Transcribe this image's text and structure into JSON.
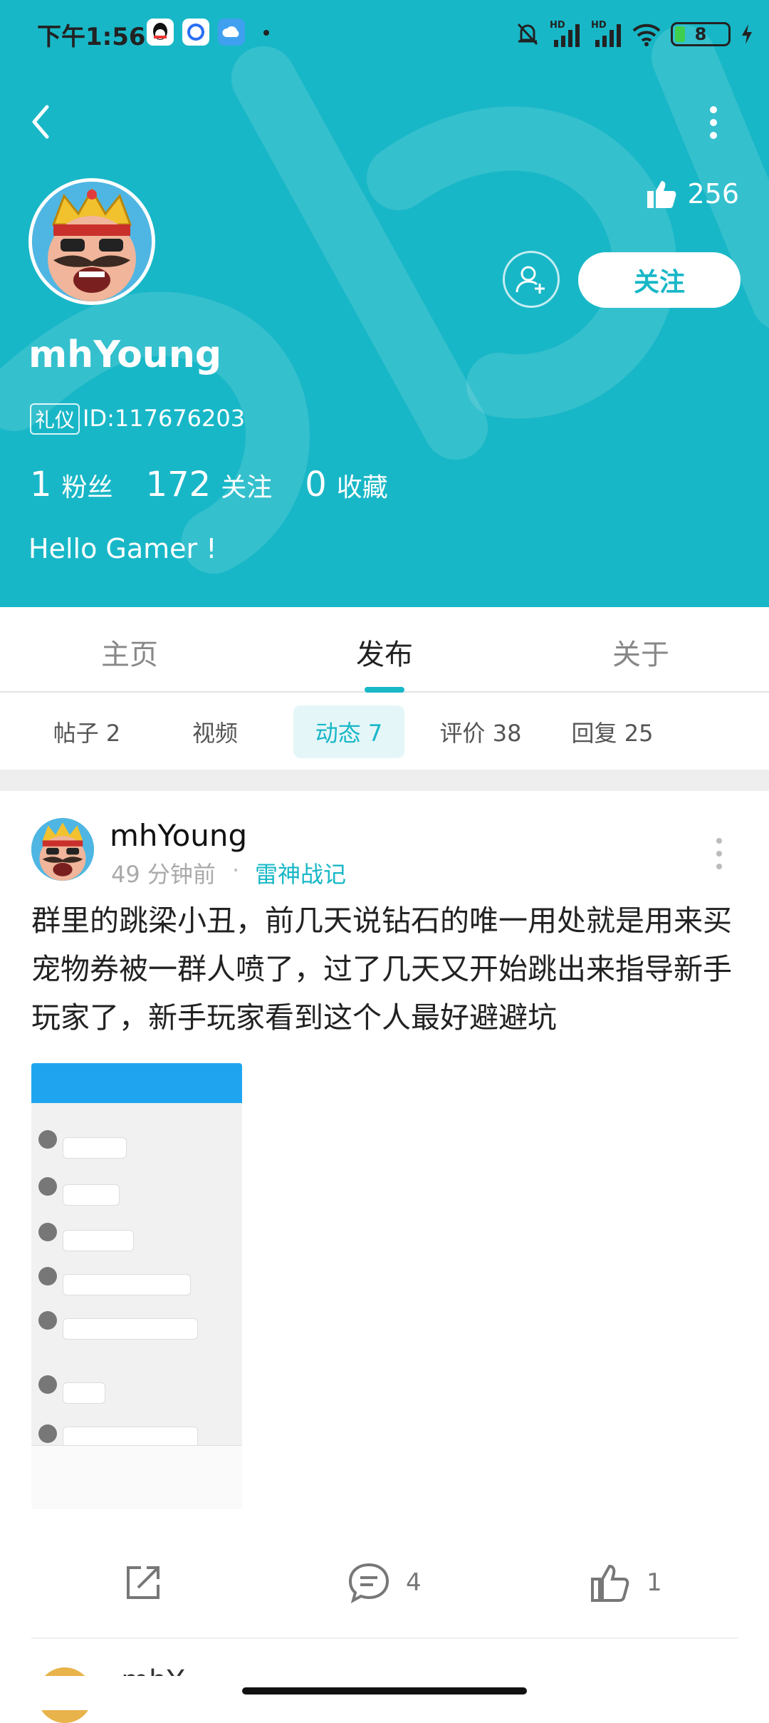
{
  "status_bar": {
    "time": "下午1:56",
    "signal_labels": [
      "HD",
      "HD"
    ],
    "battery_level": "8"
  },
  "profile": {
    "likes_count": "256",
    "follow_label": "关注",
    "username": "mhYoung",
    "badge": "礼仪",
    "user_id": "ID:117676203",
    "stats": [
      {
        "value": "1",
        "label": "粉丝"
      },
      {
        "value": "172",
        "label": "关注"
      },
      {
        "value": "0",
        "label": "收藏"
      }
    ],
    "bio": "Hello Gamer !"
  },
  "tabs": [
    {
      "label": "主页",
      "active": false
    },
    {
      "label": "发布",
      "active": true
    },
    {
      "label": "关于",
      "active": false
    }
  ],
  "subtabs": [
    {
      "label": "帖子 2",
      "active": false
    },
    {
      "label": "视频",
      "active": false
    },
    {
      "label": "动态 7",
      "active": true
    },
    {
      "label": "评价 38",
      "active": false
    },
    {
      "label": "回复 25",
      "active": false
    }
  ],
  "post": {
    "username": "mhYoung",
    "time": "49 分钟前",
    "separator": "·",
    "game": "雷神战记",
    "text": "群里的跳梁小丑，前几天说钻石的唯一用处就是用来买宠物券被一群人喷了，过了几天又开始跳出来指导新手玩家了，新手玩家看到这个人最好避避坑",
    "comment_count": "4",
    "like_count": "1"
  },
  "next_post": {
    "username_partial": "mhY"
  },
  "colors": {
    "accent": "#18b7c7",
    "header_bg": "#18b7c7",
    "text_dark": "#222222",
    "text_muted": "#888888"
  },
  "icons": {
    "back": "back-arrow-icon",
    "more": "more-vertical-icon",
    "like": "thumbs-up-icon",
    "add_friend": "add-friend-icon",
    "share": "share-icon",
    "comment": "comment-icon"
  }
}
